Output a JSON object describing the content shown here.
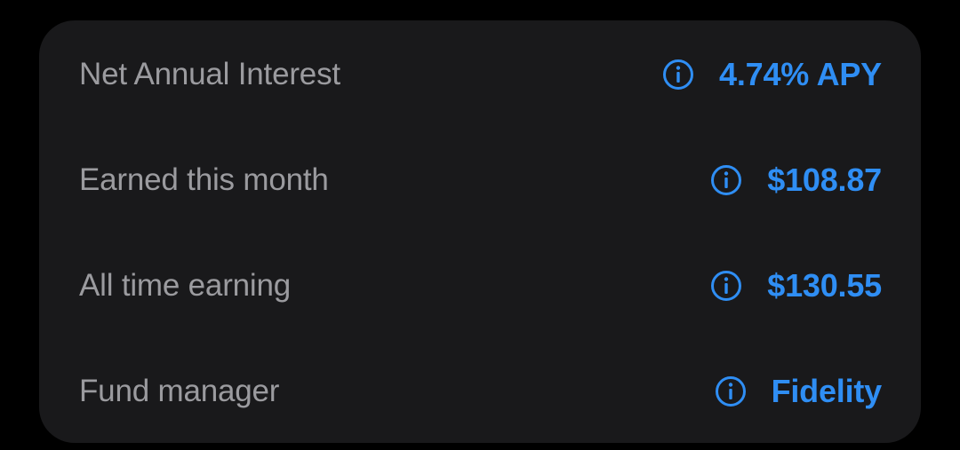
{
  "colors": {
    "background": "#000000",
    "card": "#19191b",
    "label": "#9b9b9f",
    "accent": "#2f8ef4"
  },
  "rows": [
    {
      "label": "Net Annual Interest",
      "value": "4.74% APY",
      "icon": "info-icon"
    },
    {
      "label": "Earned this month",
      "value": "$108.87",
      "icon": "info-icon"
    },
    {
      "label": "All time earning",
      "value": "$130.55",
      "icon": "info-icon"
    },
    {
      "label": "Fund manager",
      "value": "Fidelity",
      "icon": "info-icon"
    }
  ]
}
